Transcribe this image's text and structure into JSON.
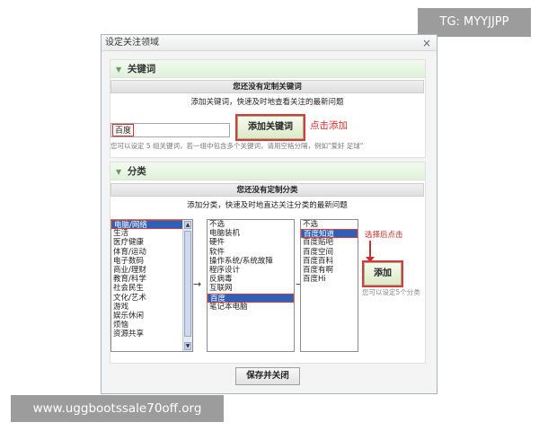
{
  "watermarks": {
    "top_right": "TG: MYYJJPP",
    "bottom_left": "www.uggbootssale70off.org"
  },
  "dialog": {
    "title": "设定关注领域",
    "close_glyph": "×"
  },
  "keywords": {
    "header": "关键词",
    "empty_notice": "您还没有定制关键词",
    "sub_notice": "添加关键词，快速及时地查看关注的最新问题",
    "input_value": "百度",
    "add_button": "添加关键词",
    "annotation": "点击添加",
    "hint": "您可以设定 5 组关键词，若一组中包含多个关键词，请用空格分隔，例如\"爱好 足球\""
  },
  "category": {
    "header": "分类",
    "empty_notice": "您还没有定制分类",
    "sub_notice": "添加分类，快速及时地直达关注分类的最新问题",
    "list1": {
      "items": [
        "电脑/网络",
        "生活",
        "医疗健康",
        "体育/运动",
        "电子数码",
        "商业/理财",
        "教育/科学",
        "社会民生",
        "文化/艺术",
        "游戏",
        "娱乐休闲",
        "烦恼",
        "资源共享"
      ],
      "selected_index": 0
    },
    "list2": {
      "items": [
        "不选",
        "电脑装机",
        "硬件",
        "软件",
        "操作系统/系统故障",
        "程序设计",
        "反病毒",
        "互联网",
        "百度",
        "笔记本电脑"
      ],
      "selected_index": 8
    },
    "list3": {
      "items": [
        "不选",
        "百度知道",
        "百度贴吧",
        "百度空间",
        "百度百科",
        "百度有啊",
        "百度Hi"
      ],
      "selected_index": 1
    },
    "annotation": "选择后点击",
    "add_button": "添加",
    "count_hint": "您可以设定5个分类"
  },
  "footer": {
    "save_button": "保存并关闭"
  },
  "colors": {
    "selection": "#2f5fb7",
    "annotation_red": "#cf2b2b",
    "section_green": "#e0f0db"
  }
}
